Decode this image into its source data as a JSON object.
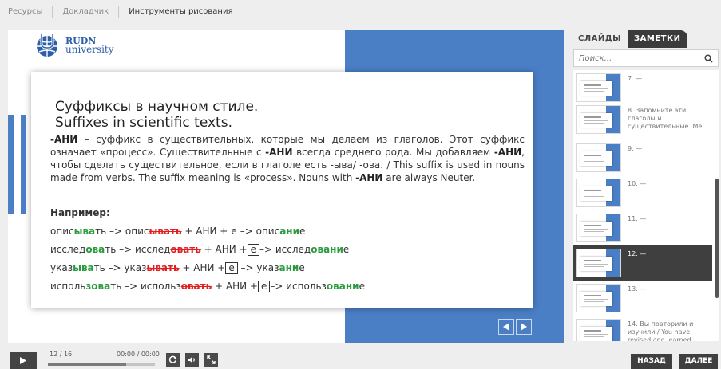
{
  "topbar": {
    "tabs": [
      {
        "label": "Ресурсы"
      },
      {
        "label": "Докладчик"
      },
      {
        "label": "Инструменты рисования"
      }
    ]
  },
  "slide": {
    "logo": {
      "line1": "RUDN",
      "line2": "university"
    },
    "title_line1": "Суффиксы в научном стиле.",
    "title_line2": "Suffixes in scientific texts.",
    "paragraph": {
      "p1": "-АНИ",
      "p2": " – суффикс в существительных, которые мы делаем из глаголов. Этот суффикс означает «процесс». Существительные с ",
      "p3": "-АНИ",
      "p4": " всегда среднего рода. Мы добавляем ",
      "p5": "-АНИ",
      "p6": ", чтобы сделать существительное, если в глаголе есть -ыва/ -ова. / This suffix is used in nouns made from verbs. The suffix meaning is «process». Nouns with ",
      "p7": "-АНИ",
      "p8": " are always Neuter."
    },
    "example_heading": "Например:",
    "examples": [
      {
        "stem": "опис",
        "suf": "ыва",
        "tail": "ть –> опис",
        "strike": "ывать",
        "plus": " + АНИ +",
        "box": "е",
        "arrow": "–> опис",
        "res": "ани",
        "end": "е"
      },
      {
        "stem": "исслед",
        "suf": "ова",
        "tail": "ть –> исслед",
        "strike": "овать",
        "plus": " + АНИ +",
        "box": "е",
        "arrow": "–> исслед",
        "res": "овани",
        "end": "е"
      },
      {
        "stem": "указ",
        "suf": "ыва",
        "tail": "ть –> указ",
        "strike": "ывать",
        "plus": " + АНИ +",
        "box": "е",
        "arrow": " –> указ",
        "res": "ани",
        "end": "е"
      },
      {
        "stem": "исполь",
        "suf": "зова",
        "tail": "ть –> использ",
        "strike": "овать",
        "plus": " + АНИ +",
        "box": "е",
        "arrow": "–> использ",
        "res": "овани",
        "end": "е"
      }
    ]
  },
  "sidebar": {
    "tab_slides": "СЛАЙДЫ",
    "tab_notes": "ЗАМЕТКИ",
    "search_placeholder": "Поиск...",
    "items": [
      {
        "label": "7. —"
      },
      {
        "label": "8. Запомните эти глаголы и существительные. Ме..."
      },
      {
        "label": "9. —"
      },
      {
        "label": "10. —"
      },
      {
        "label": "11. —"
      },
      {
        "label": "12. —"
      },
      {
        "label": "13. —"
      },
      {
        "label": "14. Вы повторили и изучили / You have revised and learned"
      }
    ],
    "selected_index": 5
  },
  "bottombar": {
    "slide_counter": "12 / 16",
    "time": "00:00 / 00:00",
    "progress": 0.73,
    "back_label": "НАЗАД",
    "next_label": "ДАЛЕЕ"
  },
  "colors": {
    "accent_blue": "#4a7ec5",
    "suffix_green": "#2a9b3c",
    "strike_red": "#e02020",
    "dark_ui": "#3f3f3f"
  }
}
